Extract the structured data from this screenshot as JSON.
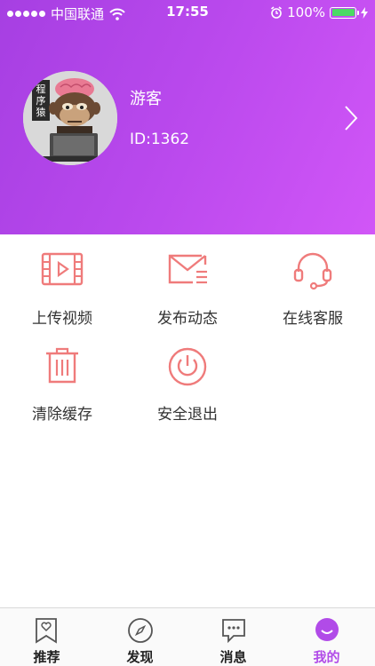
{
  "status_bar": {
    "carrier": "中国联通",
    "time": "17:55",
    "battery": "100%"
  },
  "profile": {
    "name": "游客",
    "id_text": "ID:1362",
    "avatar_caption": "程序猿"
  },
  "actions": [
    {
      "label": "上传视频",
      "icon": "video-upload-icon"
    },
    {
      "label": "发布动态",
      "icon": "envelope-icon"
    },
    {
      "label": "在线客服",
      "icon": "headset-icon"
    },
    {
      "label": "清除缓存",
      "icon": "trash-icon"
    },
    {
      "label": "安全退出",
      "icon": "power-icon"
    }
  ],
  "tabbar": {
    "items": [
      {
        "label": "推荐",
        "icon": "heart-bookmark-icon"
      },
      {
        "label": "发现",
        "icon": "compass-icon"
      },
      {
        "label": "消息",
        "icon": "chat-bubble-icon"
      },
      {
        "label": "我的",
        "icon": "profile-smile-icon"
      }
    ],
    "active_index": 3
  },
  "colors": {
    "header_start": "#a63fe2",
    "header_end": "#d156f7",
    "icon_accent": "#ef7b7b",
    "tab_active": "#b14be8"
  }
}
